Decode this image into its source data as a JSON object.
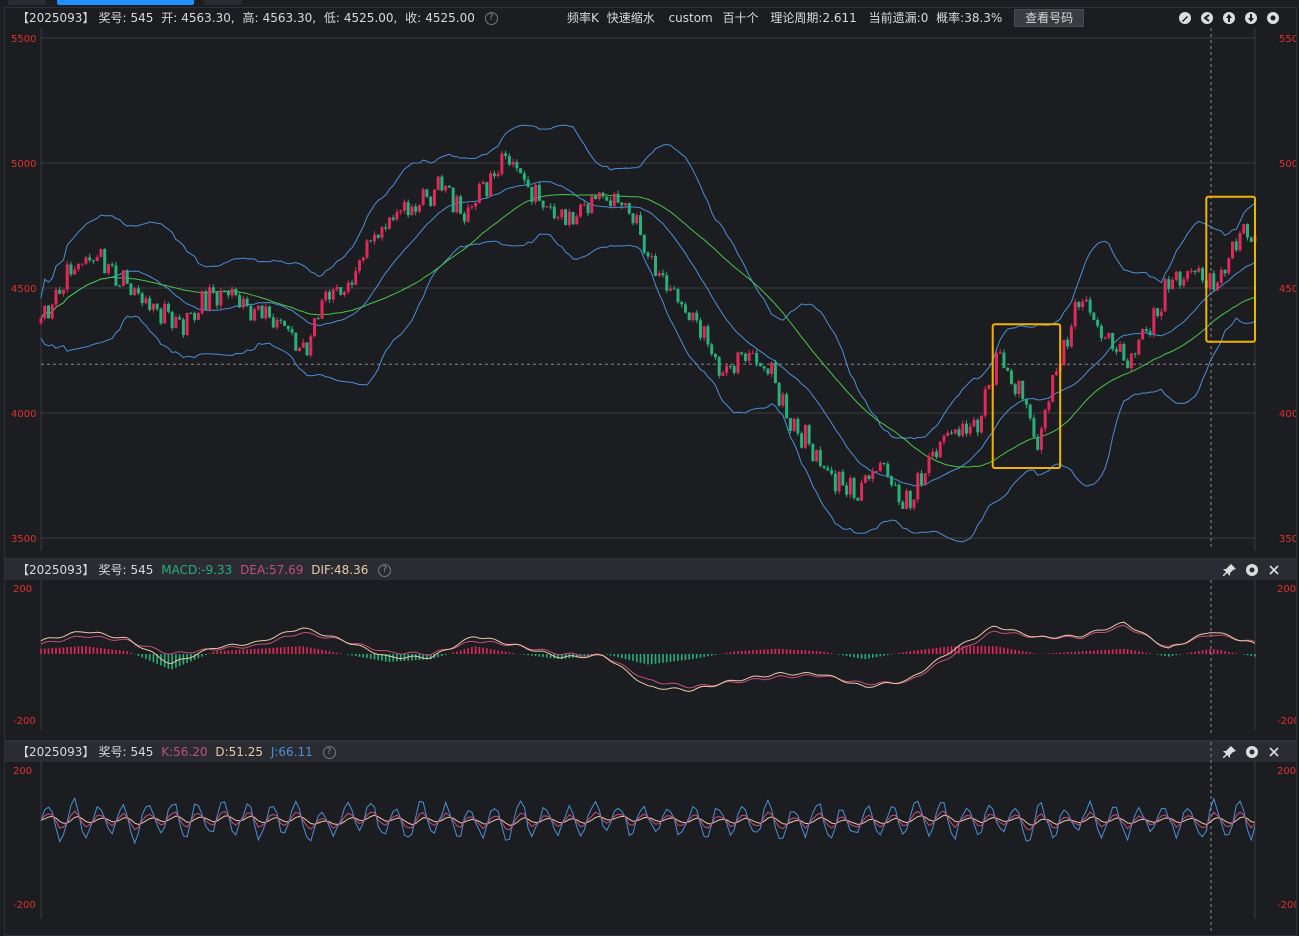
{
  "main": {
    "info": {
      "issue": "【2025093】",
      "prize_label": "奖号:",
      "prize": "545",
      "open_label": "开:",
      "open": "4563.30,",
      "high_label": "高:",
      "high": "4563.30,",
      "low_label": "低:",
      "low": "4525.00,",
      "close_label": "收:",
      "close": "4525.00"
    },
    "center": {
      "freq": "频率K",
      "fast": "快速缩水",
      "custom": "custom",
      "pos": "百十个",
      "period": "理论周期:2.611",
      "miss": "当前遗漏:0",
      "prob": "概率:38.3%",
      "view_btn": "查看号码"
    },
    "ylabels": [
      "5500",
      "5000",
      "4500",
      "4000",
      "3500"
    ]
  },
  "macd": {
    "issue": "【2025093】",
    "prize_label": "奖号:",
    "prize": "545",
    "macd_label": "MACD:",
    "macd": "-9.33",
    "dea_label": "DEA:",
    "dea": "57.69",
    "dif_label": "DIF:",
    "dif": "48.36",
    "ylabels": [
      "200",
      "-200"
    ]
  },
  "kdj": {
    "issue": "【2025093】",
    "prize_label": "奖号:",
    "prize": "545",
    "k_label": "K:",
    "k": "56.20",
    "d_label": "D:",
    "d": "51.25",
    "j_label": "J:",
    "j": "66.11",
    "ylabels": [
      "200",
      "-200"
    ]
  },
  "colors": {
    "up": "#e0285a",
    "down": "#27b07a",
    "band": "#4a8fd8",
    "ma": "#49c44a",
    "dif": "#e6c9a8",
    "dea": "#c0507a",
    "k": "#c0507a",
    "d": "#e6c9a8",
    "j": "#4a8fd8",
    "highlight": "#f0b400",
    "axis_label": "#e03030"
  },
  "chart_data": [
    {
      "type": "candlestick",
      "title": "",
      "ylim": [
        3500,
        5500
      ],
      "yticks": [
        3500,
        4000,
        4500,
        5000,
        5500
      ],
      "dashed_ref_y": 4195,
      "series_shape": [
        [
          0,
          4380
        ],
        [
          8,
          4570
        ],
        [
          15,
          4640
        ],
        [
          22,
          4520
        ],
        [
          30,
          4420
        ],
        [
          38,
          4360
        ],
        [
          45,
          4470
        ],
        [
          52,
          4480
        ],
        [
          58,
          4400
        ],
        [
          65,
          4350
        ],
        [
          70,
          4250
        ],
        [
          76,
          4440
        ],
        [
          82,
          4520
        ],
        [
          88,
          4690
        ],
        [
          94,
          4790
        ],
        [
          100,
          4820
        ],
        [
          106,
          4920
        ],
        [
          112,
          4810
        ],
        [
          118,
          4890
        ],
        [
          124,
          5050
        ],
        [
          130,
          4920
        ],
        [
          136,
          4820
        ],
        [
          142,
          4760
        ],
        [
          148,
          4880
        ],
        [
          154,
          4870
        ],
        [
          158,
          4780
        ],
        [
          164,
          4560
        ],
        [
          170,
          4440
        ],
        [
          176,
          4320
        ],
        [
          182,
          4150
        ],
        [
          188,
          4230
        ],
        [
          194,
          4180
        ],
        [
          200,
          3970
        ],
        [
          206,
          3860
        ],
        [
          212,
          3720
        ],
        [
          218,
          3680
        ],
        [
          224,
          3820
        ],
        [
          228,
          3700
        ],
        [
          232,
          3630
        ],
        [
          238,
          3860
        ],
        [
          244,
          3940
        ],
        [
          250,
          3950
        ],
        [
          256,
          4230
        ],
        [
          262,
          4060
        ],
        [
          266,
          3880
        ],
        [
          272,
          4220
        ],
        [
          278,
          4470
        ],
        [
          284,
          4290
        ],
        [
          290,
          4220
        ],
        [
          296,
          4330
        ],
        [
          302,
          4560
        ],
        [
          308,
          4550
        ],
        [
          314,
          4530
        ],
        [
          320,
          4720
        ]
      ],
      "highlight_boxes": [
        {
          "x_from_index": 254,
          "x_to_index": 272,
          "y_range": [
            3780,
            4355
          ]
        },
        {
          "x_from_index": 311,
          "x_to_index": 324,
          "y_range": [
            4285,
            4865
          ]
        }
      ]
    },
    {
      "type": "line",
      "title": "",
      "ylim": [
        -200,
        200
      ],
      "series": [
        {
          "name": "DIF",
          "values_shape": [
            40,
            70,
            45,
            -30,
            20,
            35,
            80,
            40,
            -10,
            -10,
            55,
            25,
            -10,
            -5,
            -100,
            -110,
            -80,
            -60,
            -60,
            -100,
            -80,
            10,
            85,
            50,
            55,
            95,
            15,
            70,
            30
          ]
        },
        {
          "name": "DEA",
          "values_shape": [
            30,
            55,
            40,
            0,
            15,
            25,
            65,
            40,
            5,
            0,
            40,
            25,
            0,
            -5,
            -80,
            -100,
            -85,
            -70,
            -65,
            -90,
            -85,
            -5,
            70,
            50,
            50,
            85,
            20,
            60,
            35
          ]
        }
      ]
    },
    {
      "type": "line",
      "title": "",
      "ylim": [
        -200,
        200
      ],
      "series": [
        {
          "name": "K",
          "values_shape": "oscillating"
        },
        {
          "name": "D",
          "values_shape": "oscillating"
        },
        {
          "name": "J",
          "values_shape": "oscillating"
        }
      ]
    }
  ]
}
